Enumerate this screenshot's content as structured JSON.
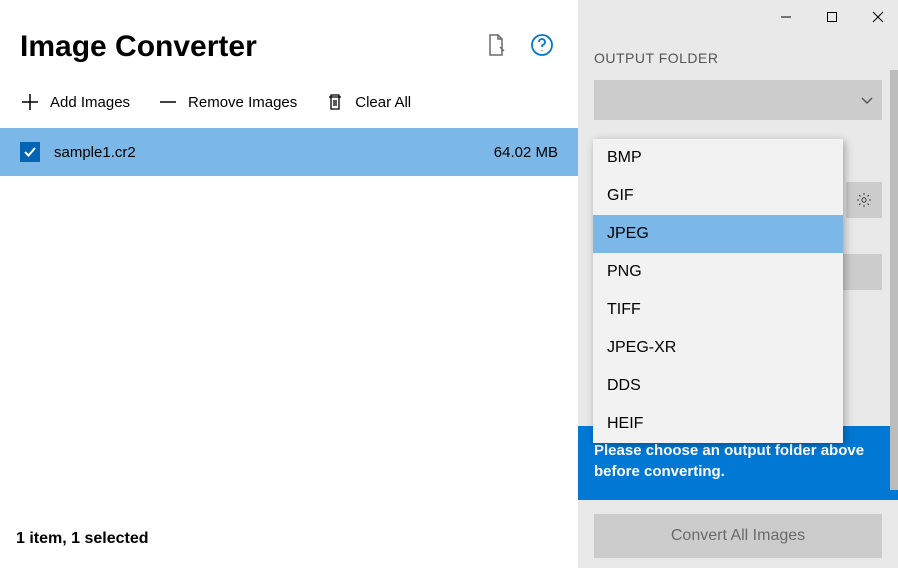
{
  "app": {
    "title": "Image Converter"
  },
  "toolbar": {
    "add": "Add Images",
    "remove": "Remove Images",
    "clear": "Clear All"
  },
  "files": [
    {
      "name": "sample1.cr2",
      "size": "64.02 MB",
      "selected": true
    }
  ],
  "status": "1 item, 1 selected",
  "right": {
    "output_folder_label": "OUTPUT FOLDER",
    "warning": "Please choose an output folder above before converting.",
    "convert_label": "Convert All Images"
  },
  "format_options": [
    "BMP",
    "GIF",
    "JPEG",
    "PNG",
    "TIFF",
    "JPEG-XR",
    "DDS",
    "HEIF"
  ],
  "format_selected": "JPEG"
}
